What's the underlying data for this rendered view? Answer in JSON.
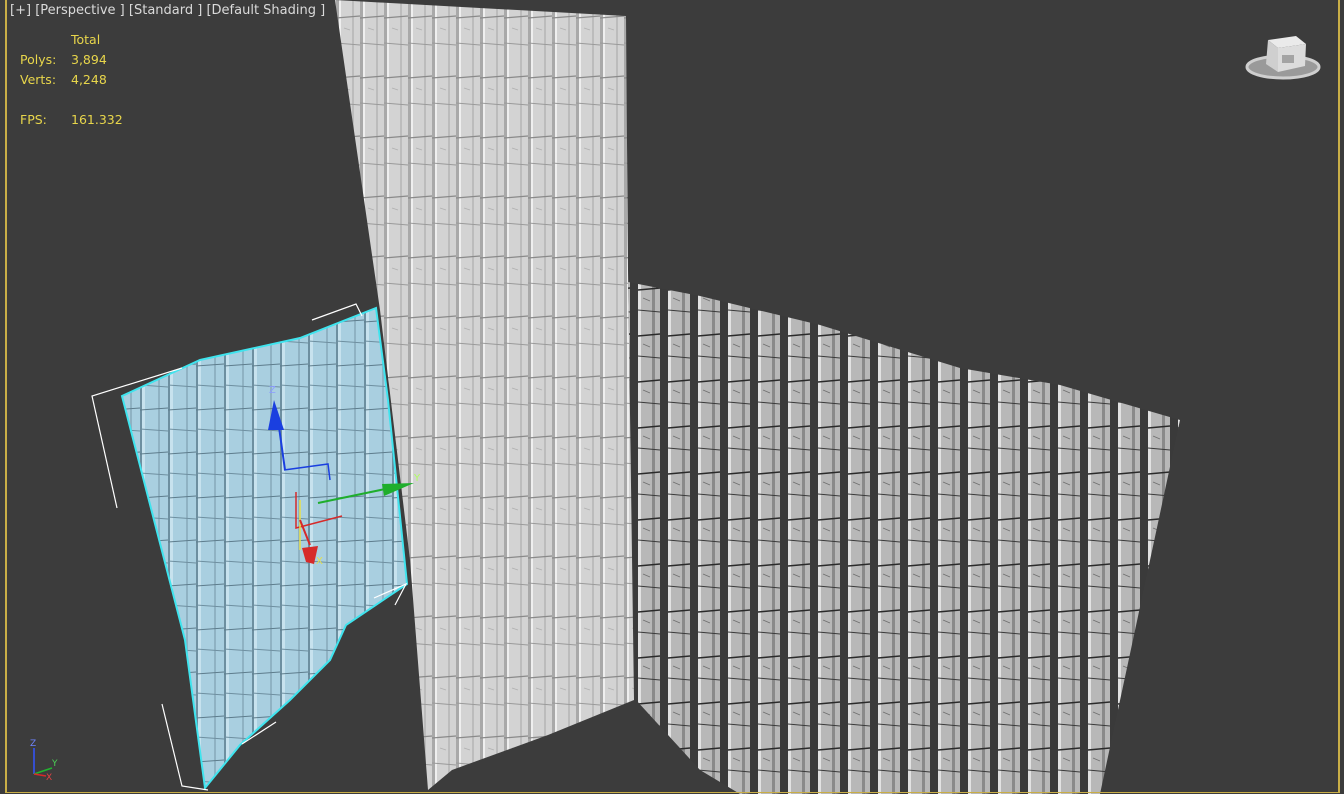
{
  "viewport": {
    "menu": {
      "plus": "[+]",
      "view": "[Perspective ]",
      "preset": "[Standard ]",
      "shading": "[Default Shading ]"
    },
    "stats": {
      "header": "Total",
      "polys_label": "Polys:",
      "polys_value": "3,894",
      "verts_label": "Verts:",
      "verts_value": "4,248",
      "fps_label": "FPS:",
      "fps_value": "161.332"
    },
    "gizmo": {
      "x": "X",
      "y": "Y",
      "z": "Z"
    },
    "axis_tripod": {
      "x": "X",
      "y": "Y",
      "z": "Z"
    }
  },
  "colors": {
    "background": "#3c3c3c",
    "frame": "#c9ae47",
    "stats_text": "#e8d64b",
    "selected_mesh": "#a9cfe0",
    "selection_outline": "#3fe4ee",
    "gizmo_x": "#d62a2a",
    "gizmo_y": "#1fae2c",
    "gizmo_z": "#1a3fe0",
    "gizmo_plane": "#e8e04a"
  },
  "icons": [
    "viewcube-icon",
    "transform-gizmo-icon",
    "axis-tripod-icon"
  ]
}
